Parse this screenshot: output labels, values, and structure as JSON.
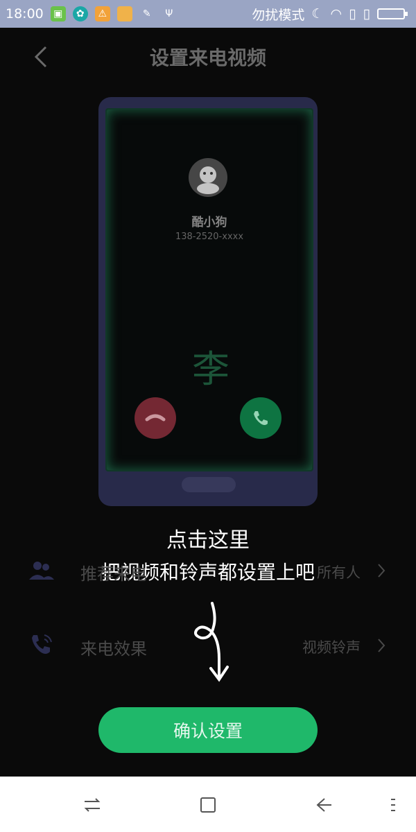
{
  "status_bar": {
    "time": "18:00",
    "dnd_text": "勿扰模式"
  },
  "header": {
    "title": "设置来电视频"
  },
  "preview": {
    "caller_name": "酷小狗",
    "caller_number": "138-2520-xxxx",
    "watermark_char": "李"
  },
  "guide": {
    "line1": "点击这里",
    "line2": "把视频和铃声都设置上吧"
  },
  "settings": {
    "row1": {
      "label": "推荐来电",
      "value": "所有人"
    },
    "row2": {
      "label": "来电效果",
      "value": "视频铃声"
    }
  },
  "confirm_button": {
    "label": "确认设置"
  },
  "colors": {
    "accent": "#1fb86a",
    "status_bar": "#9aa5c4"
  },
  "icons": {
    "back": "arrow-left",
    "recommend": "people-icon",
    "effect": "phone-ring-icon"
  }
}
